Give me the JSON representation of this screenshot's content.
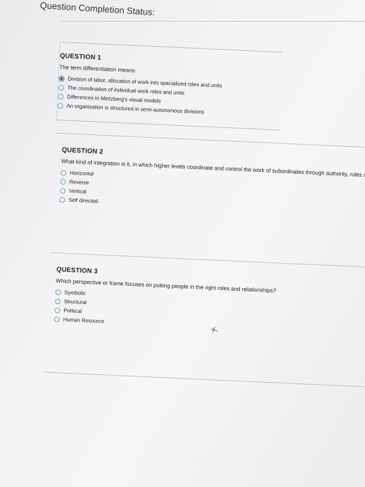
{
  "header": {
    "status_label": "Question Completion Status:"
  },
  "questions": [
    {
      "title": "QUESTION 1",
      "text": "The term differentiation means:",
      "options": [
        {
          "label": "Division of labor, allocation of work into specialized roles and units",
          "selected": true
        },
        {
          "label": "The coordination of individual work roles and units",
          "selected": false
        },
        {
          "label": "Differences in Mintzberg's visual models",
          "selected": false
        },
        {
          "label": "An organization is structured in semi-autonomous divisions",
          "selected": false
        }
      ]
    },
    {
      "title": "QUESTION 2",
      "text": "What kind of integration is it, in which higher levels coordinate and control the work of subordinates through authority, rules and policies, and planning and control systems?",
      "options": [
        {
          "label": "Horizontal",
          "selected": false
        },
        {
          "label": "Reverse",
          "selected": false
        },
        {
          "label": "Vertical",
          "selected": false
        },
        {
          "label": "Self directed",
          "selected": false
        }
      ]
    },
    {
      "title": "QUESTION 3",
      "text": "Which perspective or frame focuses on putting people in the right roles and relationships?",
      "options": [
        {
          "label": "Symbolic",
          "selected": false
        },
        {
          "label": "Structural",
          "selected": false
        },
        {
          "label": "Political",
          "selected": false
        },
        {
          "label": "Human Resource",
          "selected": false
        }
      ]
    }
  ],
  "colors": {
    "radio_border": "#6aa2b8",
    "radio_selected": "#15405a"
  },
  "icons": {
    "cursor": "mouse-pointer-icon"
  }
}
